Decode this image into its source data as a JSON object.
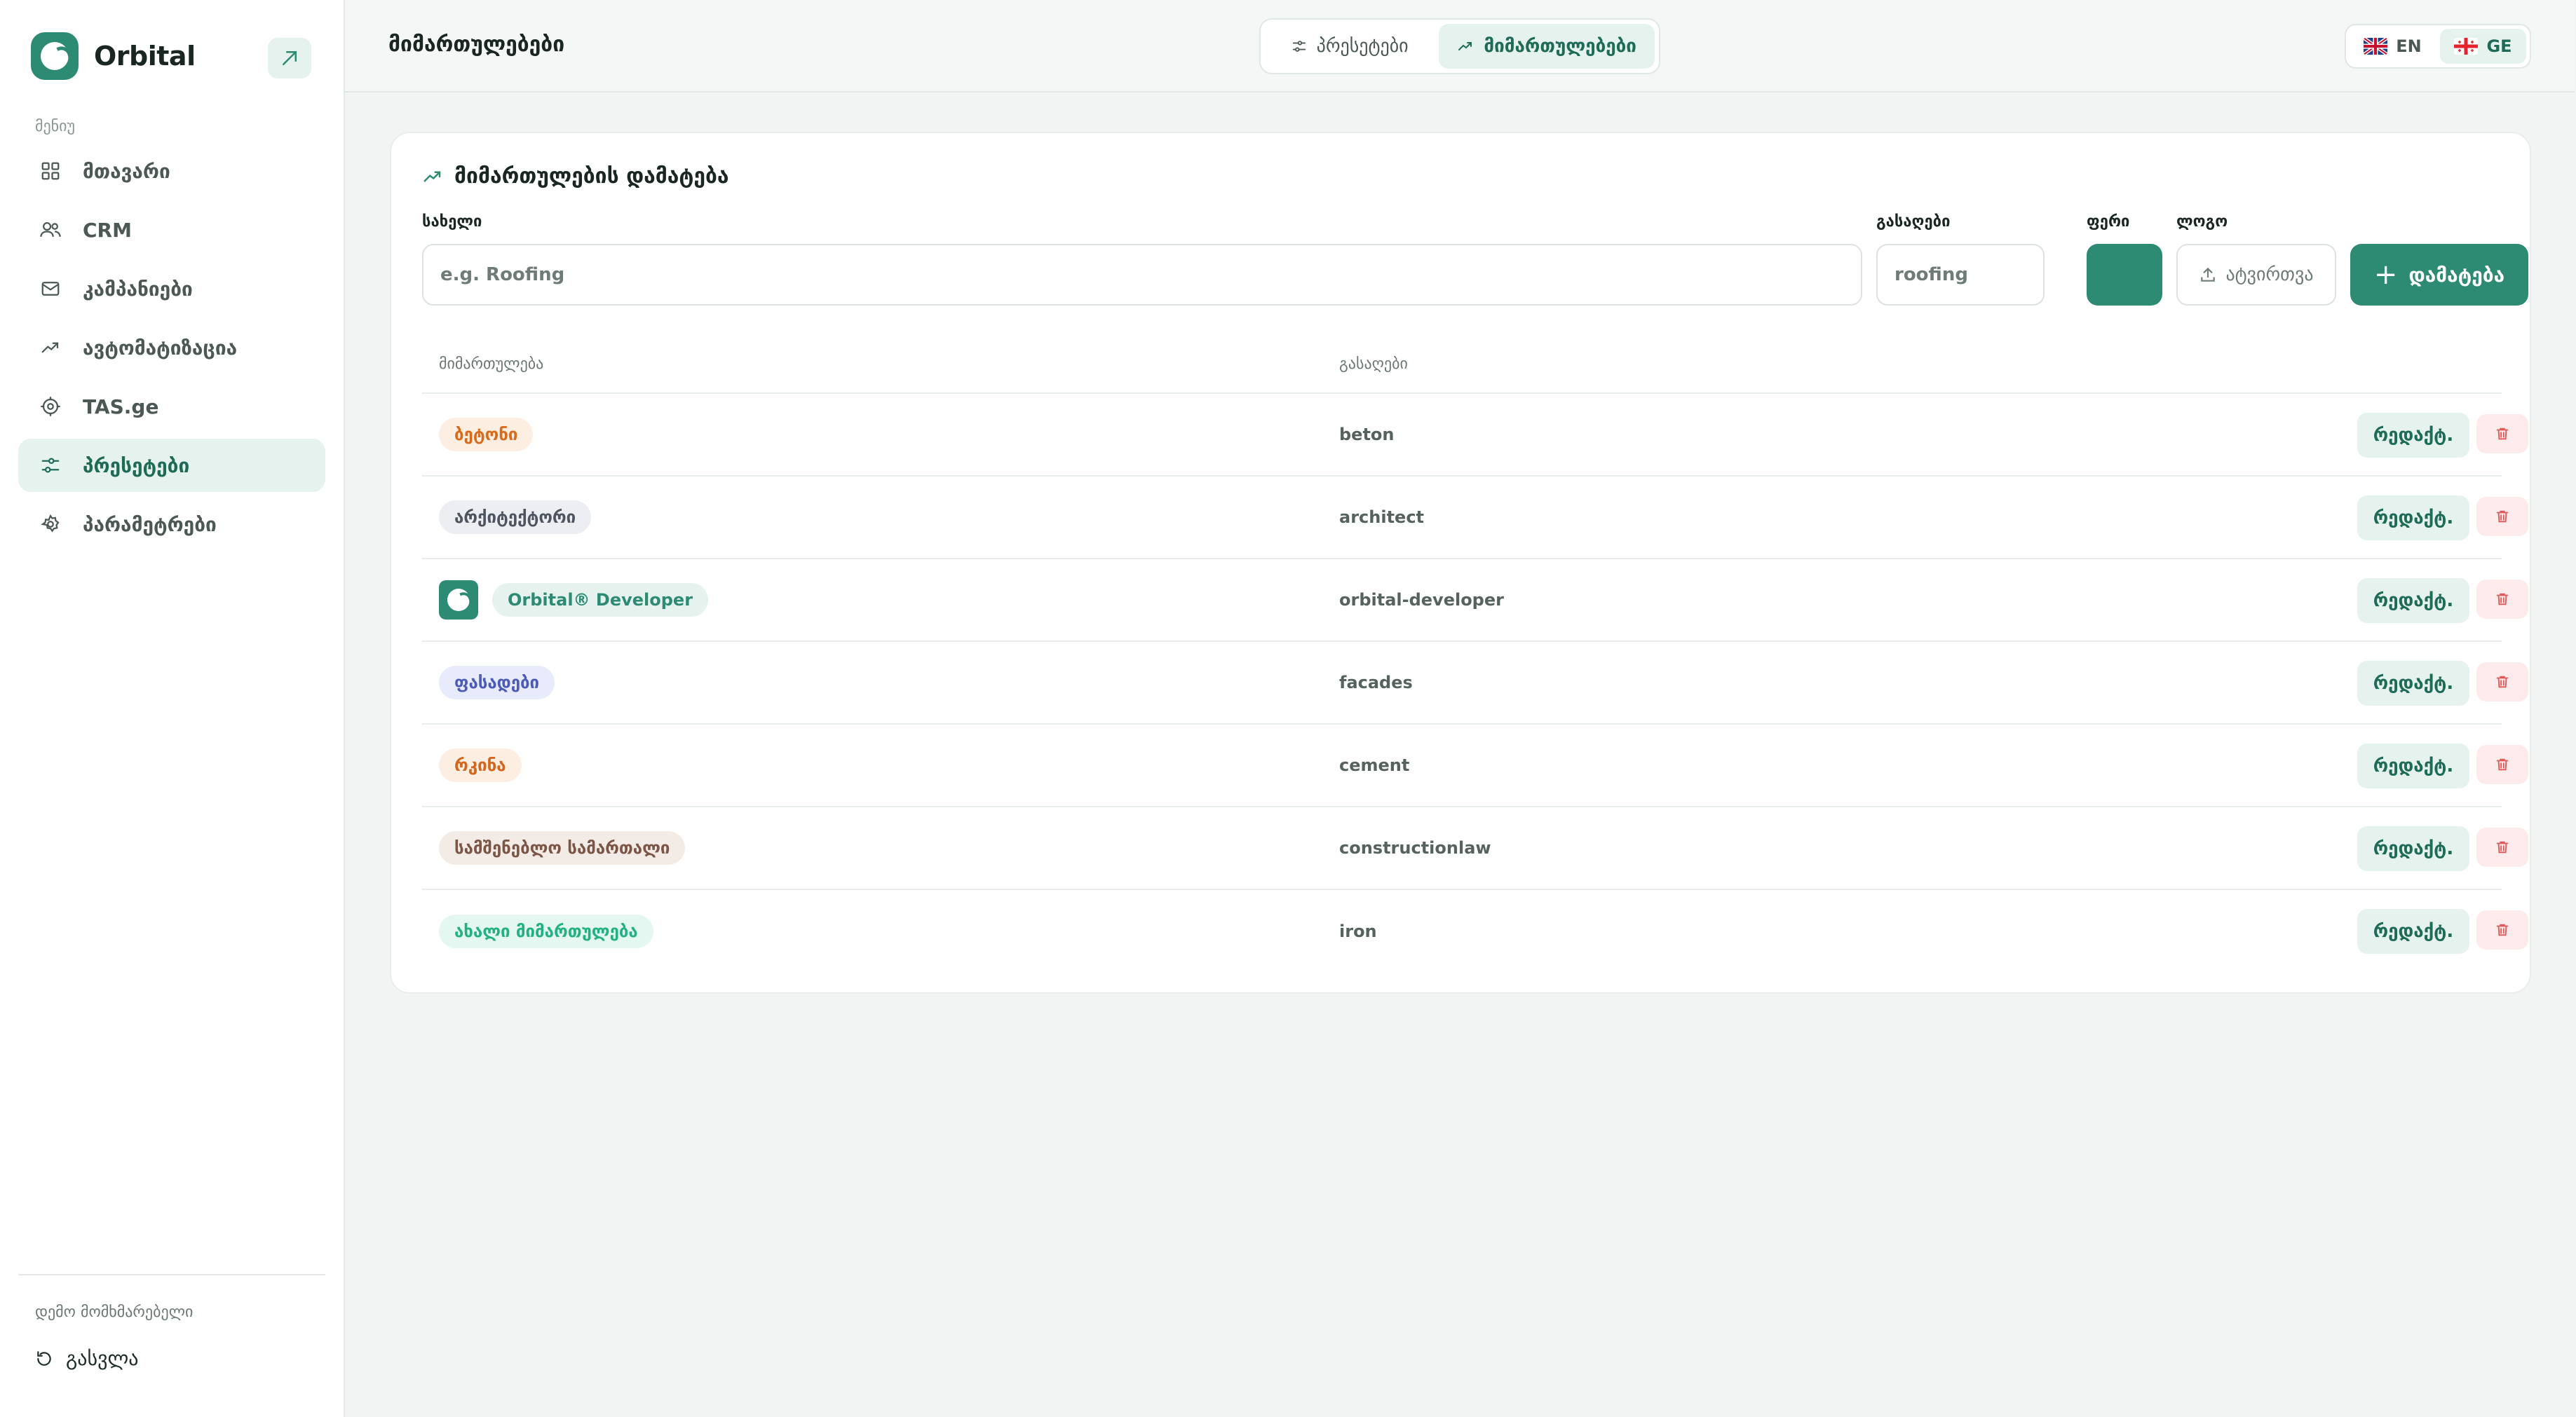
{
  "app": {
    "name": "Orbital",
    "menu_caption": "მენიუ",
    "user_name": "დემო მომხმარებელი",
    "logout_label": "გასვლა"
  },
  "sidebar": {
    "items": [
      {
        "label": "მთავარი",
        "icon": "dashboard-grid-icon",
        "active": false
      },
      {
        "label": "CRM",
        "icon": "users-icon",
        "active": false
      },
      {
        "label": "კამპანიები",
        "icon": "mail-icon",
        "active": false
      },
      {
        "label": "ავტომატიზაცია",
        "icon": "trend-icon",
        "active": false
      },
      {
        "label": "TAS.ge",
        "icon": "target-icon",
        "active": false
      },
      {
        "label": "პრესეტები",
        "icon": "sliders-icon",
        "active": true
      },
      {
        "label": "პარამეტრები",
        "icon": "gear-icon",
        "active": false
      }
    ]
  },
  "header": {
    "title": "მიმართულებები",
    "tabs": [
      {
        "label": "პრესეტები",
        "icon": "sliders-icon",
        "active": false
      },
      {
        "label": "მიმართულებები",
        "icon": "trend-icon",
        "active": true
      }
    ],
    "languages": [
      {
        "code": "EN",
        "flag": "uk-flag-icon",
        "active": false
      },
      {
        "code": "GE",
        "flag": "georgia-flag-icon",
        "active": true
      }
    ]
  },
  "form": {
    "title": "მიმართულების დამატება",
    "name_label": "სახელი",
    "name_placeholder": "e.g. Roofing",
    "name_value": "",
    "key_label": "გასაღები",
    "key_placeholder": "roofing",
    "key_value": "",
    "color_label": "ფერი",
    "color_value": "#2e8b73",
    "logo_label": "ლოგო",
    "upload_label": "ატვირთვა",
    "add_label": "დამატება"
  },
  "table": {
    "columns": [
      "მიმართულება",
      "გასაღები"
    ],
    "edit_label": "რედაქტ.",
    "rows": [
      {
        "name": "ბეტონი",
        "key": "beton",
        "bg": "#fdeee2",
        "fg": "#d96a1a",
        "logo": false
      },
      {
        "name": "არქიტექტორი",
        "key": "architect",
        "bg": "#edeef1",
        "fg": "#4e5560",
        "logo": false
      },
      {
        "name": "Orbital® Developer",
        "key": "orbital-developer",
        "bg": "#e6f2ee",
        "fg": "#2e8b73",
        "logo": true
      },
      {
        "name": "ფასადები",
        "key": "facades",
        "bg": "#e7ebfb",
        "fg": "#4a5bb8",
        "logo": false
      },
      {
        "name": "რკინა",
        "key": "cement",
        "bg": "#fdeee2",
        "fg": "#d4661c",
        "logo": false
      },
      {
        "name": "სამშენებლო სამართალი",
        "key": "constructionlaw",
        "bg": "#f3ebe6",
        "fg": "#7b5646",
        "logo": false
      },
      {
        "name": "ახალი მიმართულება",
        "key": "iron",
        "bg": "#e4f8f1",
        "fg": "#23b184",
        "logo": false
      }
    ]
  }
}
